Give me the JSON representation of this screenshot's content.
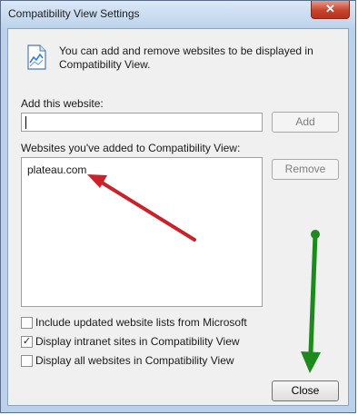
{
  "window": {
    "title": "Compatibility View Settings",
    "close_glyph": "✕"
  },
  "info": {
    "icon": "compat-view-icon",
    "text": "You can add and remove websites to be displayed in Compatibility View."
  },
  "add_website": {
    "label": "Add this website:",
    "value": "",
    "add_button": "Add"
  },
  "added_list": {
    "label": "Websites you've added to Compatibility View:",
    "items": [
      "plateau.com"
    ],
    "remove_button": "Remove"
  },
  "options": [
    {
      "label": "Include updated website lists from Microsoft",
      "checked": false
    },
    {
      "label": "Display intranet sites in Compatibility View",
      "checked": true
    },
    {
      "label": "Display all websites in Compatibility View",
      "checked": false
    }
  ],
  "close_button": "Close",
  "annotations": {
    "red_arrow_color": "#c9222a",
    "green_arrow_color": "#1e8a1e"
  }
}
